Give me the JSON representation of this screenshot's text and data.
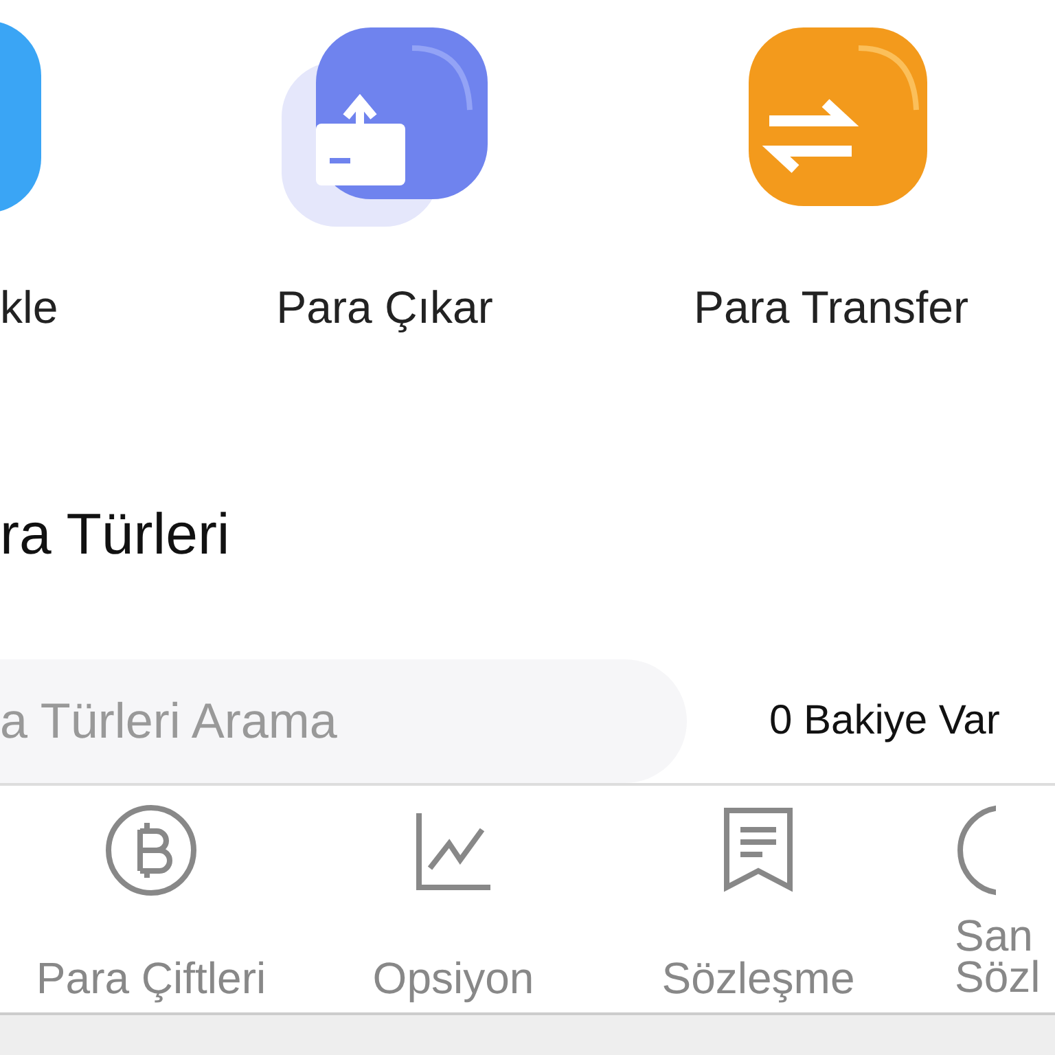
{
  "actions": [
    {
      "label": "kle"
    },
    {
      "label": "Para Çıkar"
    },
    {
      "label": "Para Transfer"
    }
  ],
  "section_title": "ra Türleri",
  "search": {
    "placeholder": "a Türleri Arama"
  },
  "filter_label": "0 Bakiye Var",
  "tabs": [
    {
      "label": "Para Çiftleri",
      "selected": false
    },
    {
      "label": "Opsiyon",
      "selected": false
    },
    {
      "label": "Sözleşme",
      "selected": false
    },
    {
      "label": "San Sözl",
      "selected": false
    }
  ]
}
